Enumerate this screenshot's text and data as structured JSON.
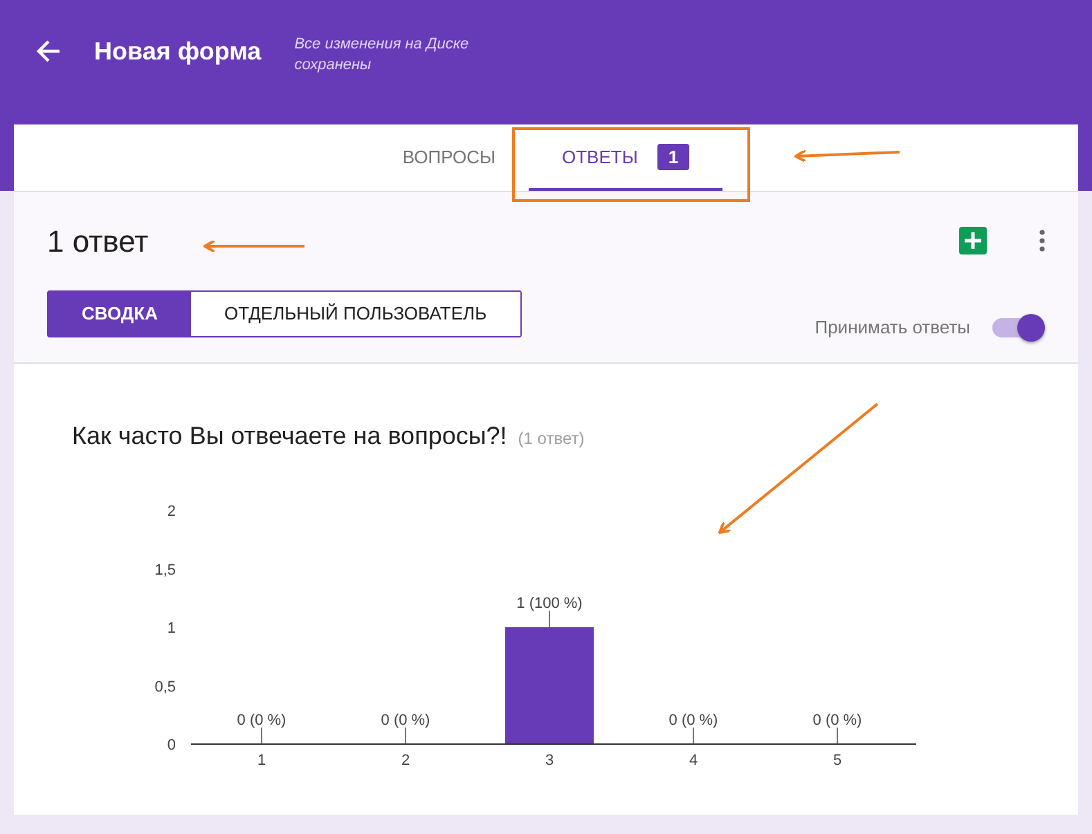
{
  "header": {
    "title": "Новая форма",
    "save_status": "Все изменения на Диске сохранены"
  },
  "tabs": [
    {
      "label": "ВОПРОСЫ",
      "selected": false
    },
    {
      "label": "ОТВЕТЫ",
      "selected": true,
      "badge": "1"
    }
  ],
  "summary": {
    "count": "1 ответ",
    "views": [
      {
        "label": "СВОДКА",
        "selected": true
      },
      {
        "label": "ОТДЕЛЬНЫЙ ПОЛЬЗОВАТЕЛЬ",
        "selected": false
      }
    ],
    "accepting_label": "Принимать ответы",
    "accepting": true
  },
  "question": {
    "title": "Как часто Вы отвечаете на вопросы?!",
    "count": "(1 ответ)",
    "chart_data": {
      "type": "bar",
      "categories": [
        "1",
        "2",
        "3",
        "4",
        "5"
      ],
      "values": [
        0,
        0,
        1,
        0,
        0
      ],
      "ylim": [
        0,
        2
      ],
      "yticks": [
        {
          "value": 0,
          "label": "0"
        },
        {
          "value": 0.5,
          "label": "0,5"
        },
        {
          "value": 1,
          "label": "1"
        },
        {
          "value": 1.5,
          "label": "1,5"
        },
        {
          "value": 2,
          "label": "2"
        }
      ],
      "value_labels": [
        "0 (0 %)",
        "0 (0 %)",
        "1 (100 %)",
        "0 (0 %)",
        "0 (0 %)"
      ]
    }
  }
}
